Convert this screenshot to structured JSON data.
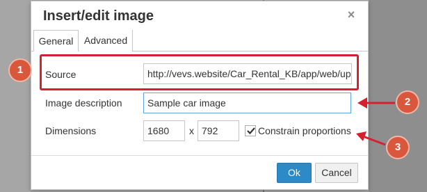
{
  "dialog": {
    "title": "Insert/edit image",
    "close_icon": "close-icon"
  },
  "tabs": [
    {
      "label": "General",
      "active": true
    },
    {
      "label": "Advanced",
      "active": false
    }
  ],
  "form": {
    "source_label": "Source",
    "source_value": "http://vevs.website/Car_Rental_KB/app/web/up",
    "description_label": "Image description",
    "description_value": "Sample car image",
    "dimensions_label": "Dimensions",
    "width_value": "1680",
    "times_symbol": "x",
    "height_value": "792",
    "constrain_label": "Constrain proportions",
    "constrain_checked": true
  },
  "buttons": {
    "ok": "Ok",
    "cancel": "Cancel"
  },
  "annotations": {
    "callouts": [
      "1",
      "2",
      "3"
    ],
    "highlight_color": "#d6202f",
    "callout_color": "#d9573c"
  },
  "colors": {
    "accent": "#2d8ac7",
    "focus_border": "#59a5e5"
  }
}
